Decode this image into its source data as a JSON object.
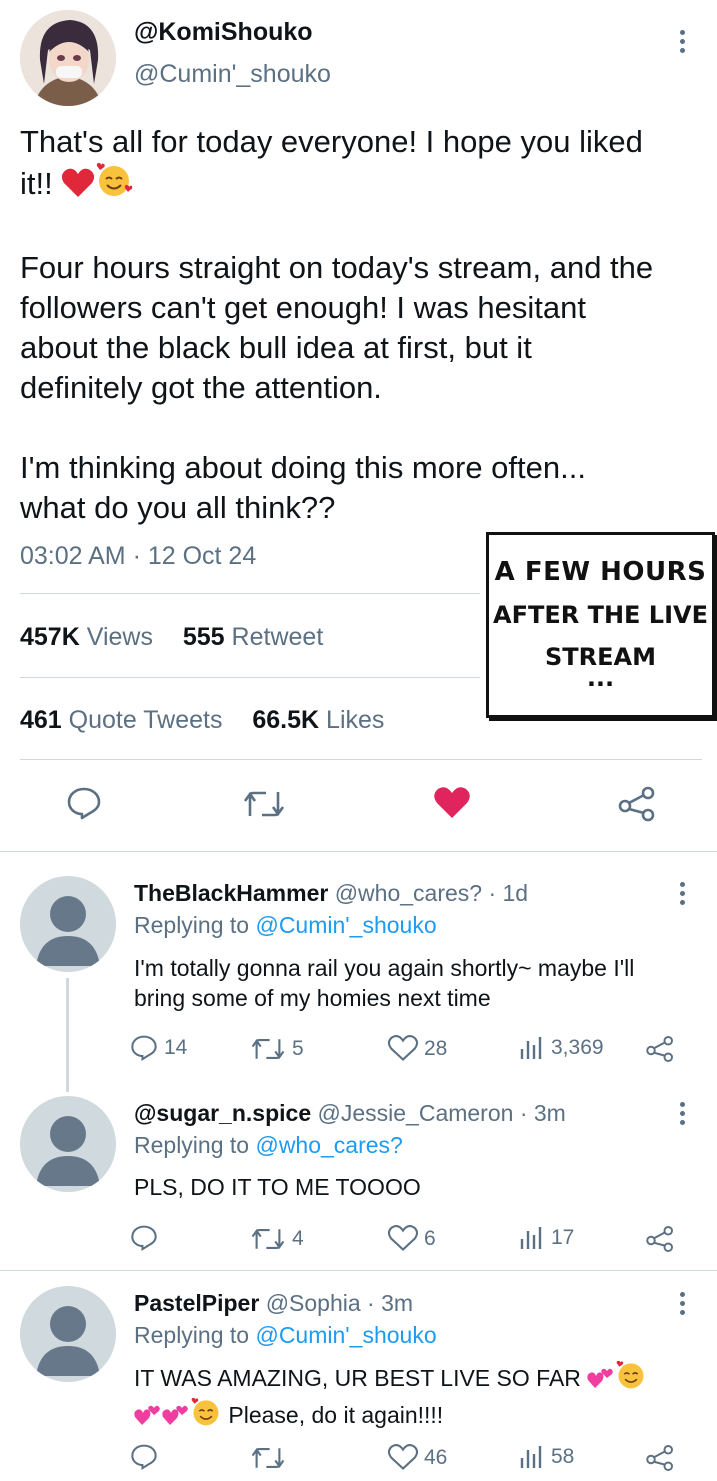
{
  "tweet": {
    "display_name": "@KomiShouko",
    "handle": "@Cumin'_shouko",
    "text_line1": "That's all for today everyone! I hope you liked",
    "text_line2": "it!!",
    "text_para2": "Four hours straight on today's stream, and the\nfollowers can't get enough! I was hesitant\nabout the black bull idea at first, but it\ndefinitely got the attention.",
    "text_para3": "I'm thinking about doing this more often...\nwhat do you all think??",
    "timestamp": "03:02 AM · 12 Oct 24",
    "views_count": "457K",
    "views_label": "Views",
    "retweets_count": "555",
    "retweets_label": "Retweet",
    "quotes_count": "461",
    "quotes_label": "Quote Tweets",
    "likes_count": "66.5K",
    "likes_label": "Likes",
    "liked": true
  },
  "caption": {
    "line1": "A FEW HOURS",
    "line2": "AFTER THE LIVE",
    "line3": "STREAM",
    "dots": "..."
  },
  "replies": [
    {
      "name": "TheBlackHammer",
      "handle": "@who_cares?",
      "time": "· 1d",
      "replying_label": "Replying to",
      "replying_to": "@Cumin'_shouko",
      "text": "I'm totally gonna rail you again shortly~ maybe I'll bring some of my homies next time",
      "replies": "14",
      "retweets": "5",
      "likes": "28",
      "views": "3,369"
    },
    {
      "name": "@sugar_n.spice",
      "handle": "@Jessie_Cameron",
      "time": "· 3m",
      "replying_label": "Replying to",
      "replying_to": "@who_cares?",
      "text": "PLS, DO IT TO ME TOOOO",
      "replies": "",
      "retweets": "4",
      "likes": "6",
      "views": "17"
    },
    {
      "name": "PastelPiper",
      "handle": "@Sophia",
      "time": "· 3m",
      "replying_label": "Replying to",
      "replying_to": "@Cumin'_shouko",
      "text_line1": "IT WAS AMAZING, UR BEST LIVE SO FAR",
      "text_line2": "Please, do it again!!!!",
      "replies": "",
      "retweets": "",
      "likes": "46",
      "views": "58"
    }
  ],
  "colors": {
    "accent": "#1d9bf0",
    "like_red": "#e0245e",
    "muted": "#5b7083",
    "divider": "#cfd9de"
  }
}
